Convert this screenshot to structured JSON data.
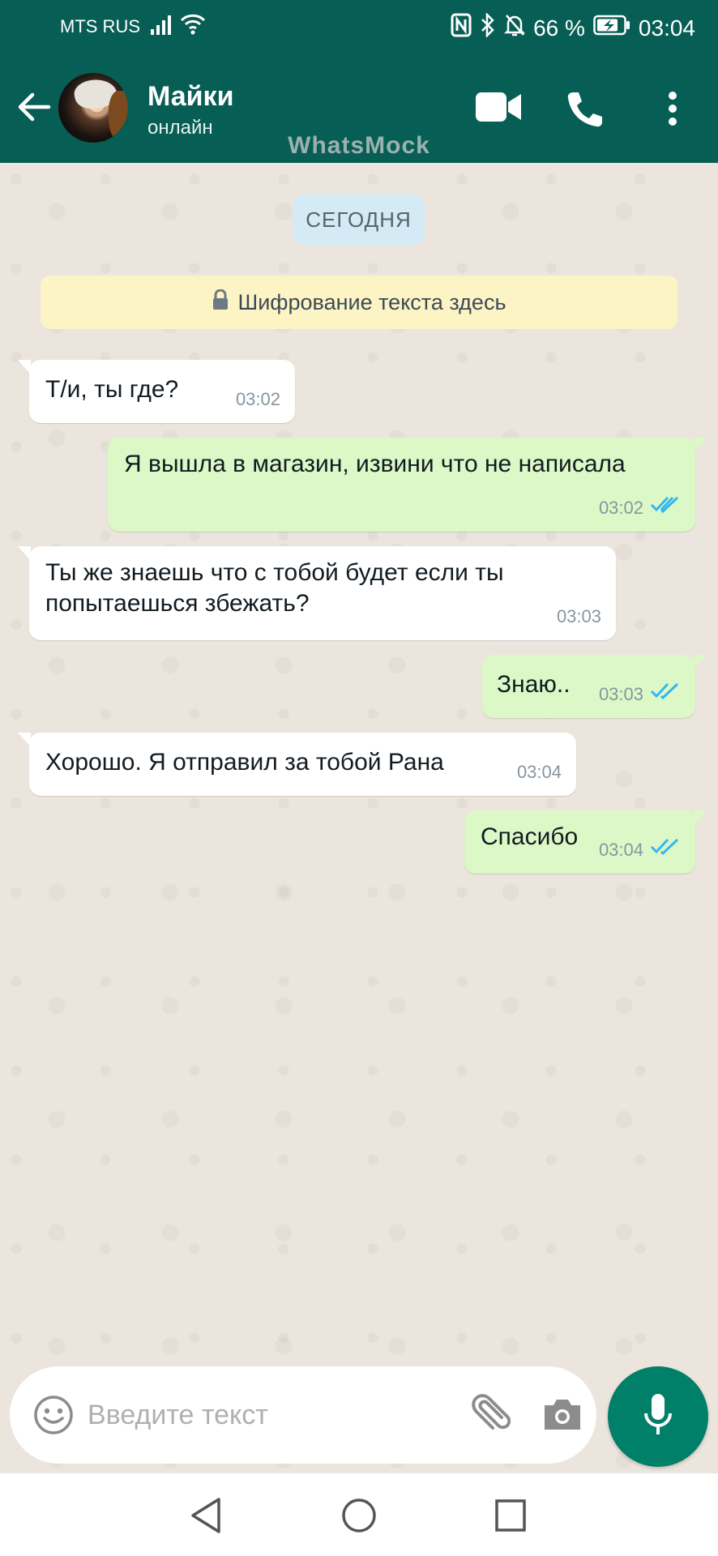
{
  "status_bar": {
    "carrier": "MTS RUS",
    "battery_percent": "66 %",
    "time": "03:04"
  },
  "header": {
    "contact_name": "Майки",
    "contact_status": "онлайн",
    "watermark": "WhatsMock"
  },
  "chat": {
    "date_chip": "СЕГОДНЯ",
    "encryption_notice": "Шифрование текста здесь",
    "messages": [
      {
        "direction": "in",
        "lines": [
          "Т/и, ты где?"
        ],
        "time": "03:02"
      },
      {
        "direction": "out",
        "lines": [
          "Я вышла в магазин, извини что не написала"
        ],
        "time": "03:02",
        "read": true
      },
      {
        "direction": "in",
        "lines": [
          "Ты же знаешь что с тобой будет если ты",
          "попытаешься збежать?"
        ],
        "time": "03:03"
      },
      {
        "direction": "out",
        "lines": [
          "Знаю.."
        ],
        "time": "03:03",
        "read": true
      },
      {
        "direction": "in",
        "lines": [
          "Хорошо. Я отправил за тобой Рана"
        ],
        "time": "03:04"
      },
      {
        "direction": "out",
        "lines": [
          "Спасибо"
        ],
        "time": "03:04",
        "read": true
      }
    ]
  },
  "composer": {
    "placeholder": "Введите текст",
    "value": ""
  },
  "icons": {
    "header": [
      "back-arrow-icon",
      "video-call-icon",
      "voice-call-icon",
      "more-options-icon"
    ],
    "composer": [
      "emoji-icon",
      "attach-icon",
      "camera-icon",
      "mic-icon"
    ],
    "nav": [
      "nav-back-icon",
      "nav-home-icon",
      "nav-recents-icon"
    ]
  },
  "colors": {
    "header_bg": "#075e54",
    "chat_bg": "#ece5dd",
    "outgoing_bubble": "#dcf8c6",
    "incoming_bubble": "#ffffff",
    "read_ticks": "#34b7f1",
    "mic_button": "#008069",
    "date_chip": "#d4eaf4",
    "encryption_banner": "#fdf4c5"
  }
}
